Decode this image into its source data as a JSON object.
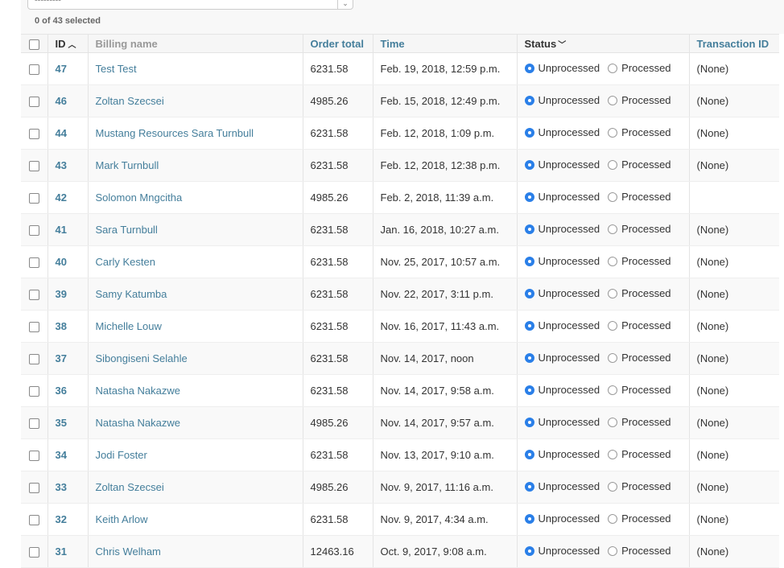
{
  "action_bar": {
    "action_select_value": "---------",
    "selection_counter": "0 of 43 selected"
  },
  "table": {
    "headers": {
      "id": "ID",
      "billing_name": "Billing name",
      "order_total": "Order total",
      "time": "Time",
      "status": "Status",
      "transaction_id": "Transaction ID"
    },
    "status_options": [
      "Unprocessed",
      "Processed"
    ],
    "rows": [
      {
        "id": "47",
        "billing_name": "Test Test",
        "order_total": "6231.58",
        "time": "Feb. 19, 2018, 12:59 p.m.",
        "status": "Unprocessed",
        "transaction_id": "(None)"
      },
      {
        "id": "46",
        "billing_name": "Zoltan Szecsei",
        "order_total": "4985.26",
        "time": "Feb. 15, 2018, 12:49 p.m.",
        "status": "Unprocessed",
        "transaction_id": "(None)"
      },
      {
        "id": "44",
        "billing_name": "Mustang Resources Sara Turnbull",
        "order_total": "6231.58",
        "time": "Feb. 12, 2018, 1:09 p.m.",
        "status": "Unprocessed",
        "transaction_id": "(None)"
      },
      {
        "id": "43",
        "billing_name": "Mark Turnbull",
        "order_total": "6231.58",
        "time": "Feb. 12, 2018, 12:38 p.m.",
        "status": "Unprocessed",
        "transaction_id": "(None)"
      },
      {
        "id": "42",
        "billing_name": "Solomon Mngcitha",
        "order_total": "4985.26",
        "time": "Feb. 2, 2018, 11:39 a.m.",
        "status": "Unprocessed",
        "transaction_id": ""
      },
      {
        "id": "41",
        "billing_name": "Sara Turnbull",
        "order_total": "6231.58",
        "time": "Jan. 16, 2018, 10:27 a.m.",
        "status": "Unprocessed",
        "transaction_id": "(None)"
      },
      {
        "id": "40",
        "billing_name": "Carly Kesten",
        "order_total": "6231.58",
        "time": "Nov. 25, 2017, 10:57 a.m.",
        "status": "Unprocessed",
        "transaction_id": "(None)"
      },
      {
        "id": "39",
        "billing_name": "Samy Katumba",
        "order_total": "6231.58",
        "time": "Nov. 22, 2017, 3:11 p.m.",
        "status": "Unprocessed",
        "transaction_id": "(None)"
      },
      {
        "id": "38",
        "billing_name": "Michelle Louw",
        "order_total": "6231.58",
        "time": "Nov. 16, 2017, 11:43 a.m.",
        "status": "Unprocessed",
        "transaction_id": "(None)"
      },
      {
        "id": "37",
        "billing_name": "Sibongiseni Selahle",
        "order_total": "6231.58",
        "time": "Nov. 14, 2017, noon",
        "status": "Unprocessed",
        "transaction_id": "(None)"
      },
      {
        "id": "36",
        "billing_name": "Natasha Nakazwe",
        "order_total": "6231.58",
        "time": "Nov. 14, 2017, 9:58 a.m.",
        "status": "Unprocessed",
        "transaction_id": "(None)"
      },
      {
        "id": "35",
        "billing_name": "Natasha Nakazwe",
        "order_total": "4985.26",
        "time": "Nov. 14, 2017, 9:57 a.m.",
        "status": "Unprocessed",
        "transaction_id": "(None)"
      },
      {
        "id": "34",
        "billing_name": "Jodi Foster",
        "order_total": "6231.58",
        "time": "Nov. 13, 2017, 9:10 a.m.",
        "status": "Unprocessed",
        "transaction_id": "(None)"
      },
      {
        "id": "33",
        "billing_name": "Zoltan Szecsei",
        "order_total": "4985.26",
        "time": "Nov. 9, 2017, 11:16 a.m.",
        "status": "Unprocessed",
        "transaction_id": "(None)"
      },
      {
        "id": "32",
        "billing_name": "Keith Arlow",
        "order_total": "6231.58",
        "time": "Nov. 9, 2017, 4:34 a.m.",
        "status": "Unprocessed",
        "transaction_id": "(None)"
      },
      {
        "id": "31",
        "billing_name": "Chris Welham",
        "order_total": "12463.16",
        "time": "Oct. 9, 2017, 9:08 a.m.",
        "status": "Unprocessed",
        "transaction_id": "(None)"
      }
    ]
  },
  "icons": {
    "sort_ascending": "chevron-up-icon",
    "status_dropdown": "chevron-down-icon",
    "select_arrow": "select-arrows-icon"
  },
  "colors": {
    "link": "#447e9b",
    "radio_selected": "#2a7fe8"
  }
}
